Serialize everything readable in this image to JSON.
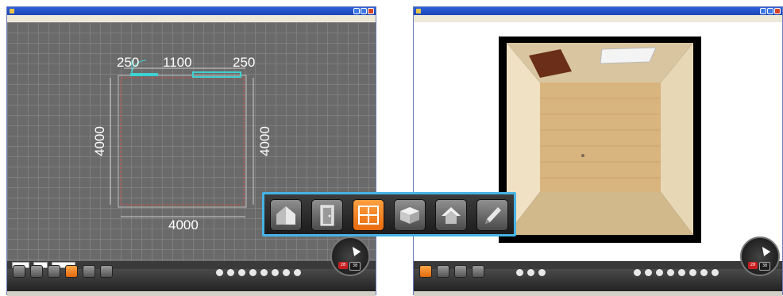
{
  "left_window": {
    "menu": [
      "",
      "",
      ""
    ],
    "dimensions": {
      "top_left": "250",
      "top_middle": "1100",
      "top_right": "250",
      "left_side": "4000",
      "right_side": "4000",
      "bottom": "4000"
    }
  },
  "right_window": {
    "menu": [
      "",
      "",
      ""
    ]
  },
  "compass": {
    "badge_red": "28",
    "badge_dark": "38"
  },
  "palette": {
    "tools": [
      "roof-wall-icon",
      "door-icon",
      "window-grid-icon",
      "box-icon",
      "roof-icon",
      "pencil-icon"
    ],
    "active": "window-grid-icon"
  },
  "colors": {
    "accent_orange": "#e66a0e",
    "highlight_blue": "#47b3e6",
    "titlebar_blue": "#1a45b8"
  }
}
